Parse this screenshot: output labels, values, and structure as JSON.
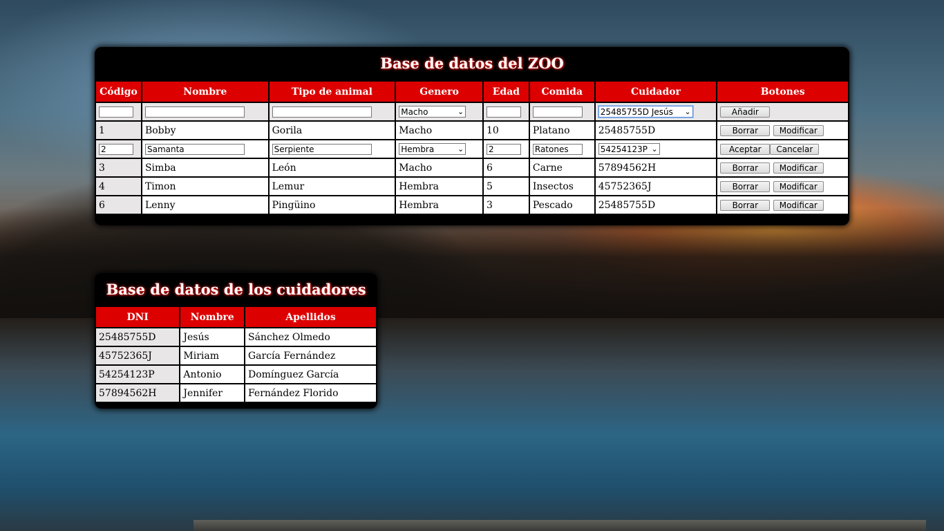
{
  "zoo": {
    "title": "Base de datos del ZOO",
    "headers": [
      "Código",
      "Nombre",
      "Tipo de animal",
      "Genero",
      "Edad",
      "Comida",
      "Cuidador",
      "Botones"
    ],
    "new_row": {
      "genero": "Macho",
      "cuidador": "25485755D Jesús",
      "add_label": "Añadir"
    },
    "rows": [
      {
        "codigo": "1",
        "nombre": "Bobby",
        "tipo": "Gorila",
        "genero": "Macho",
        "edad": "10",
        "comida": "Platano",
        "cuidador": "25485755D"
      },
      {
        "codigo": "2",
        "nombre": "Samanta",
        "tipo": "Serpiente",
        "genero": "Hembra",
        "edad": "2",
        "comida": "Ratones",
        "cuidador": "54254123P"
      },
      {
        "codigo": "3",
        "nombre": "Simba",
        "tipo": "León",
        "genero": "Macho",
        "edad": "6",
        "comida": "Carne",
        "cuidador": "57894562H"
      },
      {
        "codigo": "4",
        "nombre": "Timon",
        "tipo": "Lemur",
        "genero": "Hembra",
        "edad": "5",
        "comida": "Insectos",
        "cuidador": "45752365J"
      },
      {
        "codigo": "6",
        "nombre": "Lenny",
        "tipo": "Pingüino",
        "genero": "Hembra",
        "edad": "3",
        "comida": "Pescado",
        "cuidador": "25485755D"
      }
    ],
    "buttons": {
      "delete": "Borrar",
      "edit": "Modificar",
      "accept": "Aceptar",
      "cancel": "Cancelar"
    }
  },
  "keepers": {
    "title": "Base de datos de los cuidadores",
    "headers": [
      "DNI",
      "Nombre",
      "Apellidos"
    ],
    "rows": [
      {
        "dni": "25485755D",
        "nombre": "Jesús",
        "apellidos": "Sánchez Olmedo"
      },
      {
        "dni": "45752365J",
        "nombre": "Miriam",
        "apellidos": "García Fernández"
      },
      {
        "dni": "54254123P",
        "nombre": "Antonio",
        "apellidos": "Domínguez García"
      },
      {
        "dni": "57894562H",
        "nombre": "Jennifer",
        "apellidos": "Fernández Florido"
      }
    ]
  },
  "colors": {
    "header_red": "#dd0000",
    "panel_black": "#000000",
    "cell_grey": "#e8e6e6"
  },
  "icons": {
    "select_chevron": "chevron-down-icon"
  }
}
